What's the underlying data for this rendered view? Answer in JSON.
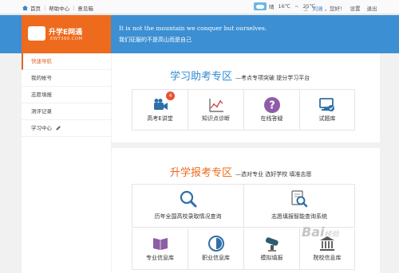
{
  "topbar": {
    "home": "首页",
    "help": "帮助中心",
    "feedback": "意见箱",
    "weather_text": "晴",
    "temp_low": "16℃",
    "temp_sep": "~",
    "temp_high": "25℃",
    "user_prefix": "上",
    "username": "刘涵",
    "hello": "，您好！",
    "settings": "设置",
    "logout": "退出"
  },
  "header": {
    "logo_mark": "EWT",
    "logo_name": "升学E网通",
    "logo_url": "EWT360.COM",
    "slogan_en": "It is not the mountain we conquer but ourselves.",
    "slogan_cn": "我们征服的不是高山而是自己"
  },
  "sidebar": {
    "items": [
      {
        "label": "快速导航"
      },
      {
        "label": "我的帐号"
      },
      {
        "label": "志愿填报"
      },
      {
        "label": "测评记录"
      },
      {
        "label": "学习中心"
      }
    ]
  },
  "study_section": {
    "title": "学习助考专区",
    "subtitle": "—考点专项突破 提分学习平台",
    "tiles": [
      {
        "label": "高考E讲堂",
        "icon": "video-camera-icon",
        "badge": "4"
      },
      {
        "label": "知识点诊断",
        "icon": "line-chart-icon"
      },
      {
        "label": "在线答疑",
        "icon": "question-icon"
      },
      {
        "label": "试题库",
        "icon": "monitor-check-icon"
      }
    ]
  },
  "admission_section": {
    "title": "升学报考专区",
    "subtitle": "—选对专业 选好学校 填准志愿",
    "wide_tiles": [
      {
        "label": "历年全国高校录取情况查询",
        "icon": "search-icon"
      },
      {
        "label": "志愿填报智能查询系统",
        "icon": "document-search-icon"
      }
    ],
    "small_tiles": [
      {
        "label": "专业信息库",
        "icon": "book-icon"
      },
      {
        "label": "职业信息库",
        "icon": "half-circle-icon"
      },
      {
        "label": "模拟填报",
        "icon": "diploma-icon"
      },
      {
        "label": "院校信息库",
        "icon": "building-icon"
      }
    ]
  },
  "watermark": {
    "text": "Bai",
    "suffix": "经验"
  },
  "colors": {
    "brand_blue": "#3c8fd3",
    "brand_orange": "#ee6a1c",
    "badge_red": "#e94f30",
    "purple": "#8e5ca8",
    "teal_blue": "#2f6fa8"
  }
}
